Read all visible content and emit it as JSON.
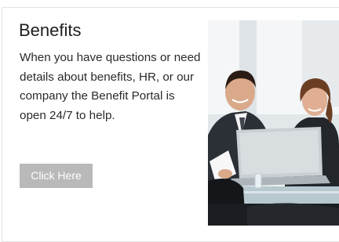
{
  "card": {
    "title": "Benefits",
    "description": "When you have questions or need details about benefits, HR, or our company the Benefit Portal is open 24/7 to help.",
    "button_label": "Click Here",
    "button_color": "#b9b9b9",
    "photo_subject": "business-meeting-photo"
  }
}
